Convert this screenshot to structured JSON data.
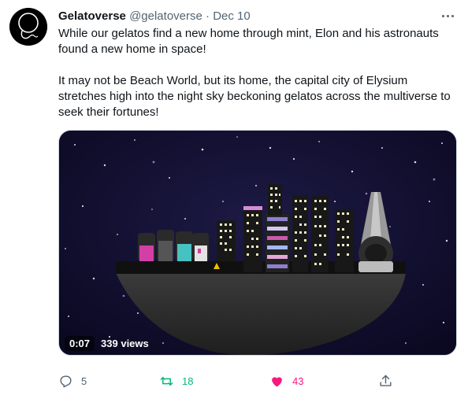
{
  "tweet": {
    "author_name": "Gelatoverse",
    "handle": "@gelatoverse",
    "separator": "·",
    "date": "Dec 10",
    "paragraph_1": "While our gelatos find a new home through mint, Elon and his astronauts found a new home in space!",
    "paragraph_2": "It may not be Beach World, but its home, the capital city of Elysium stretches high into the night sky beckoning gelatos across the multiverse to seek their fortunes!"
  },
  "video": {
    "time": "0:07",
    "views": "339 views"
  },
  "actions": {
    "reply_count": "5",
    "retweet_count": "18",
    "like_count": "43"
  },
  "colors": {
    "retweet_active": "#00ba7c",
    "like_active": "#f91880",
    "muted": "#536471",
    "sky": "#120f2e"
  },
  "icons": {
    "more": "more-horizontal-icon",
    "reply": "reply-icon",
    "retweet": "retweet-icon",
    "like": "heart-icon",
    "share": "share-icon"
  }
}
